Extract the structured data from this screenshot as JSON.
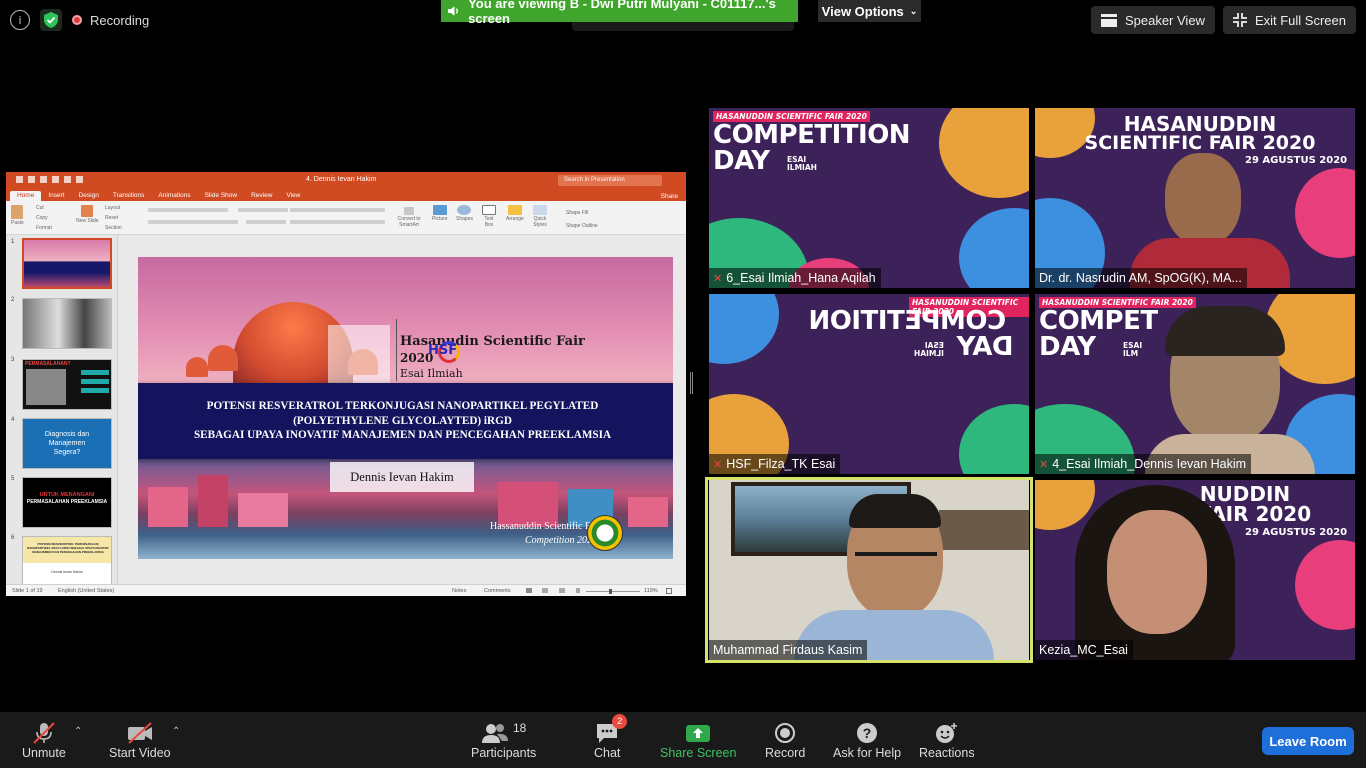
{
  "top_bar": {
    "recording_label": "Recording",
    "viewing_banner": "You are viewing B - Dwi Putri Mulyani - C01117...'s screen",
    "view_options_label": "View Options",
    "speaker_view_label": "Speaker View",
    "exit_fullscreen_label": "Exit Full Screen"
  },
  "ppt": {
    "window_title": "4. Dennis Ievan Hakim",
    "search_placeholder": "Search in Presentation",
    "share_label": "Share",
    "tabs": [
      "Home",
      "Insert",
      "Design",
      "Transitions",
      "Animations",
      "Slide Show",
      "Review",
      "View"
    ],
    "ribbon": {
      "paste": "Paste",
      "cut": "Cut",
      "copy": "Copy",
      "format": "Format",
      "new_slide": "New Slide",
      "layout": "Layout",
      "reset": "Reset",
      "section": "Section",
      "convert_smartart": "Convert to SmartArt",
      "picture": "Picture",
      "shapes": "Shapes",
      "text_box": "Text Box",
      "arrange": "Arrange",
      "quick_styles": "Quick Styles",
      "shape_fill": "Shape Fill",
      "shape_outline": "Shape Outline"
    },
    "thumb_numbers": [
      "1",
      "2",
      "3",
      "4",
      "5",
      "6"
    ],
    "thumb_texts": {
      "t3": "PERMASALAHAN?",
      "t4": "Diagnosis dan Manajemen Segera?",
      "t5_line1": "UNTUK MENANGANI",
      "t5_line2": "PERMASALAHAN PREEKLAMSIA",
      "t6": "POTENSI RESVERATROL TERKONJUGASI NANOPARTIKEL PEGYLATED SEBAGAI UPAYA INOVATIF MANAJEMEN DAN PENCEGAHAN PREEKLAMSIA",
      "t6_author": "Dennis Ievan Hakim"
    },
    "slide": {
      "fair_title": "Hasanudin Scientific Fair",
      "fair_year": "2020",
      "hsf_logo": "HSF",
      "esai_label": "Esai Ilmiah",
      "title_line1": "POTENSI RESVERATROL TERKONJUGASI NANOPARTIKEL PEGYLATED",
      "title_line2": "(POLYETHYLENE GLYCOLAYTED) iRGD",
      "title_line3": "SEBAGAI UPAYA INOVATIF MANAJEMEN DAN PENCEGAHAN PREEKLAMSIA",
      "presenter": "Dennis Ievan Hakim",
      "footer_org": "Hassanuddin Scientific Fair",
      "footer_comp": "Competition 2020"
    },
    "status": {
      "slide_count": "Slide 1 of 19",
      "language": "English (United States)",
      "notes": "Notes",
      "comments": "Comments",
      "zoom": "119%"
    }
  },
  "tiles": [
    {
      "name": "6_Esai Ilmiah_Hana Aqilah",
      "muted": true,
      "hsf_tag": "HASANUDDIN SCIENTIFIC FAIR 2020",
      "title1": "COMPETITION",
      "title2": "DAY",
      "esai": "ESAI\nILMIAH"
    },
    {
      "name": "Dr. dr. Nasrudin AM, SpOG(K), MA...",
      "muted": false,
      "fair1": "HASANUDDIN",
      "fair2": "SCIENTIFIC FAIR 2020",
      "date": "29 AGUSTUS 2020"
    },
    {
      "name": "HSF_Filza_TK Esai",
      "muted": true,
      "hsf_tag": "HASANUDDIN SCIENTIFIC FAIR 2020",
      "title1": "COMPETITION",
      "title2": "DAY",
      "esai": "ESAI\nILMIAH"
    },
    {
      "name": "4_Esai Ilmiah_Dennis Ievan Hakim",
      "muted": true,
      "hsf_tag": "HASANUDDIN SCIENTIFIC FAIR 2020",
      "title1": "COMPET",
      "title2": "DAY",
      "esai": "ESAI\nILM"
    },
    {
      "name": "Muhammad Firdaus Kasim",
      "muted": false
    },
    {
      "name": "Kezia_MC_Esai",
      "muted": false,
      "fair1": "NUDDIN",
      "fair2": "FAIR 2020",
      "date": "29 AGUSTUS 2020"
    }
  ],
  "toolbar": {
    "unmute": "Unmute",
    "start_video": "Start Video",
    "participants": "Participants",
    "participants_count": "18",
    "chat": "Chat",
    "chat_badge": "2",
    "share_screen": "Share Screen",
    "record": "Record",
    "ask_help": "Ask for Help",
    "reactions": "Reactions",
    "leave": "Leave Room"
  },
  "colors": {
    "zoom_green": "#40a52c",
    "leave_blue": "#1e6fd9",
    "ppt_orange": "#d04a22",
    "active_speaker": "#d5e36b",
    "badge_red": "#e84a3e"
  }
}
